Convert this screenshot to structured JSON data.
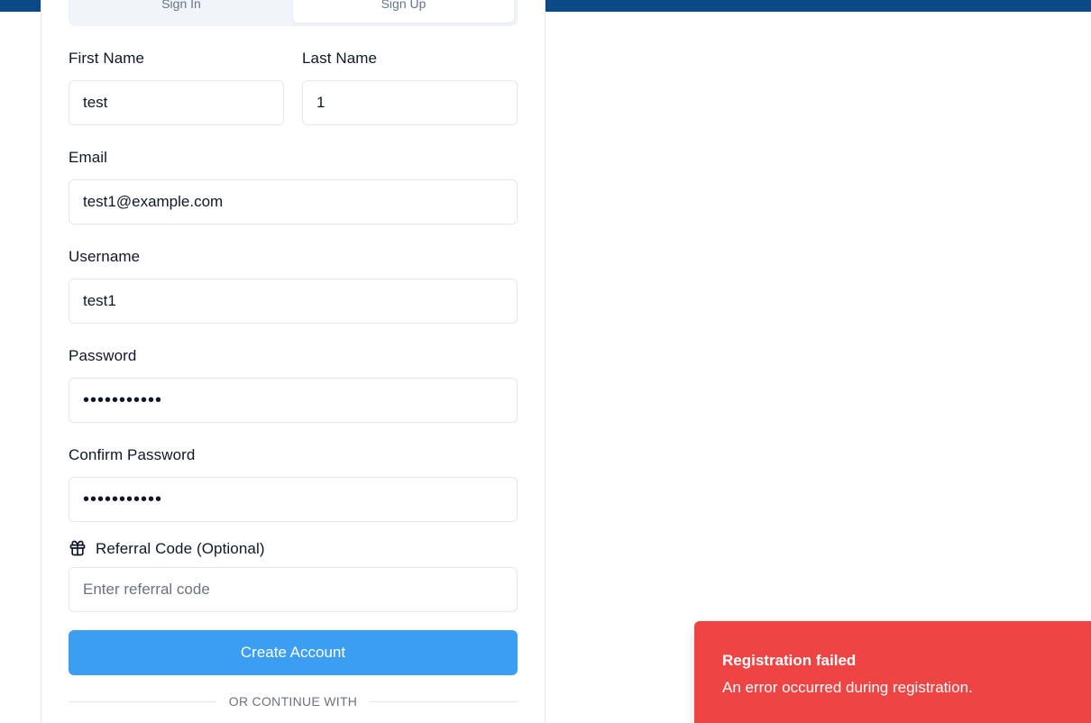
{
  "tabs": {
    "signin": "Sign In",
    "signup": "Sign Up"
  },
  "form": {
    "first_name_label": "First Name",
    "first_name_value": "test",
    "last_name_label": "Last Name",
    "last_name_value": "1",
    "email_label": "Email",
    "email_value": "test1@example.com",
    "username_label": "Username",
    "username_value": "test1",
    "password_label": "Password",
    "password_value": "•••••••••••",
    "confirm_password_label": "Confirm Password",
    "confirm_password_value": "•••••••••••",
    "referral_label": "Referral Code (Optional)",
    "referral_placeholder": "Enter referral code",
    "referral_icon": "gift-icon",
    "create_account_label": "Create Account",
    "divider_text": "OR CONTINUE WITH"
  },
  "toast": {
    "title": "Registration failed",
    "description": "An error occurred during registration.",
    "color": "#ef4444"
  },
  "colors": {
    "topbar": "#0b4a87",
    "primary_button": "#3b9ef3"
  }
}
